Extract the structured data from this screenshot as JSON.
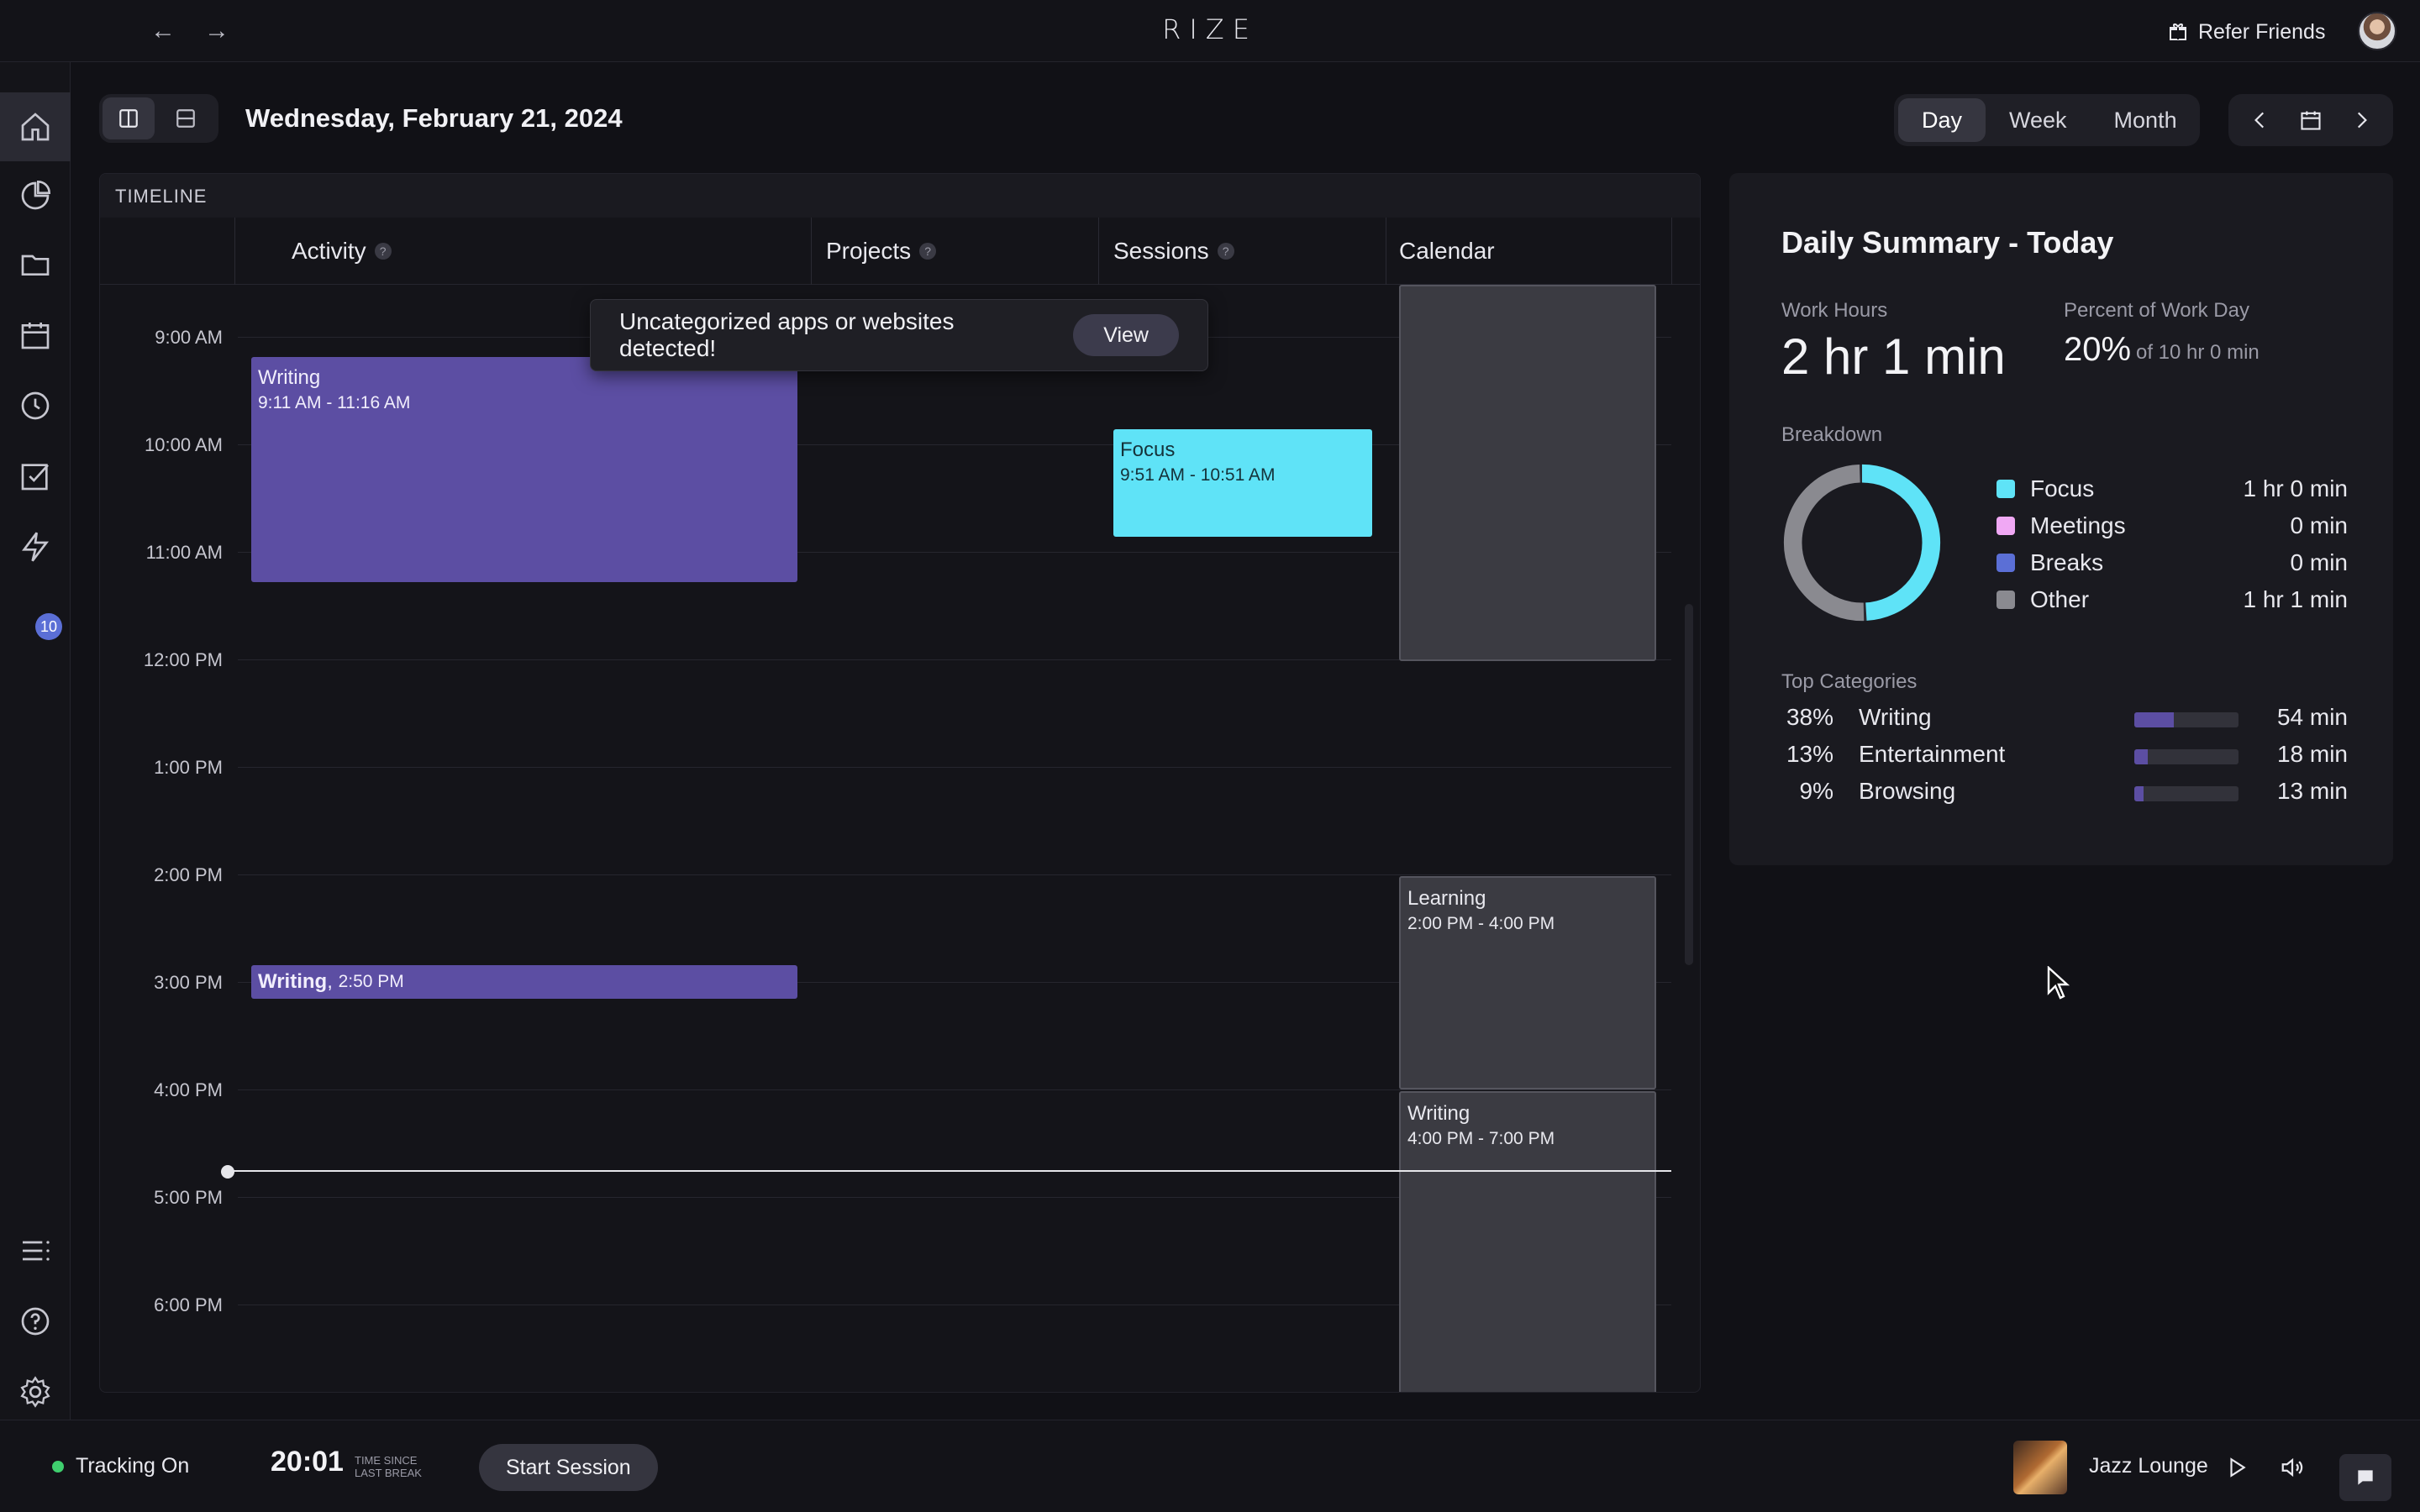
{
  "app": {
    "brand": "RIZE"
  },
  "topbar": {
    "refer_label": "Refer Friends",
    "back_icon": "arrow-left-icon",
    "forward_icon": "arrow-right-icon"
  },
  "sidebar": {
    "items": [
      {
        "name": "home",
        "icon": "home-icon",
        "active": true
      },
      {
        "name": "analytics",
        "icon": "pie-chart-icon"
      },
      {
        "name": "projects",
        "icon": "folder-icon"
      },
      {
        "name": "calendar",
        "icon": "calendar-icon"
      },
      {
        "name": "history",
        "icon": "clock-icon"
      },
      {
        "name": "tasks",
        "icon": "checkbox-icon"
      },
      {
        "name": "automations",
        "icon": "lightning-icon",
        "badge": "10"
      }
    ],
    "bottom_items": [
      {
        "name": "list",
        "icon": "list-icon"
      },
      {
        "name": "help",
        "icon": "help-icon"
      },
      {
        "name": "settings",
        "icon": "gear-icon"
      }
    ]
  },
  "header": {
    "date": "Wednesday, February 21, 2024",
    "range_tabs": [
      {
        "label": "Day",
        "active": true
      },
      {
        "label": "Week"
      },
      {
        "label": "Month"
      }
    ]
  },
  "timeline": {
    "title": "TIMELINE",
    "columns": [
      "Activity",
      "Projects",
      "Sessions",
      "Calendar"
    ],
    "hours": [
      "9:00 AM",
      "10:00 AM",
      "11:00 AM",
      "12:00 PM",
      "1:00 PM",
      "2:00 PM",
      "3:00 PM",
      "4:00 PM",
      "5:00 PM",
      "6:00 PM"
    ],
    "activity_events": [
      {
        "title": "Writing",
        "time": "9:11 AM - 11:16 AM"
      },
      {
        "title": "Writing",
        "time": "2:50 PM"
      }
    ],
    "session_events": [
      {
        "title": "Focus",
        "time": "9:51 AM - 10:51 AM"
      }
    ],
    "calendar_events": [
      {
        "title": "",
        "time": ""
      },
      {
        "title": "Learning",
        "time": "2:00 PM - 4:00 PM"
      },
      {
        "title": "Writing",
        "time": "4:00 PM - 7:00 PM"
      }
    ]
  },
  "toast": {
    "message": "Uncategorized apps or websites detected!",
    "button": "View"
  },
  "summary": {
    "title": "Daily Summary - Today",
    "work_hours_label": "Work Hours",
    "work_hours_value": "2 hr 1 min",
    "percent_label": "Percent of Work Day",
    "percent_value": "20%",
    "percent_of": "of 10 hr 0 min",
    "breakdown_label": "Breakdown",
    "breakdown": [
      {
        "label": "Focus",
        "value": "1 hr 0 min",
        "color": "#5fe3f7",
        "fraction": 0.496
      },
      {
        "label": "Meetings",
        "value": "0 min",
        "color": "#f0a8f4",
        "fraction": 0
      },
      {
        "label": "Breaks",
        "value": "0 min",
        "color": "#5b6fd6",
        "fraction": 0
      },
      {
        "label": "Other",
        "value": "1 hr 1 min",
        "color": "#8a8a90",
        "fraction": 0.504
      }
    ],
    "top_categories_label": "Top Categories",
    "top_categories": [
      {
        "pct": "38%",
        "name": "Writing",
        "value": "54 min",
        "fraction": 0.38
      },
      {
        "pct": "13%",
        "name": "Entertainment",
        "value": "18 min",
        "fraction": 0.13
      },
      {
        "pct": "9%",
        "name": "Browsing",
        "value": "13 min",
        "fraction": 0.09
      }
    ]
  },
  "bottombar": {
    "tracking_label": "Tracking On",
    "timer": "20:01",
    "timer_caption": "TIME SINCE LAST BREAK",
    "start_session": "Start Session",
    "track_name": "Jazz Lounge"
  }
}
